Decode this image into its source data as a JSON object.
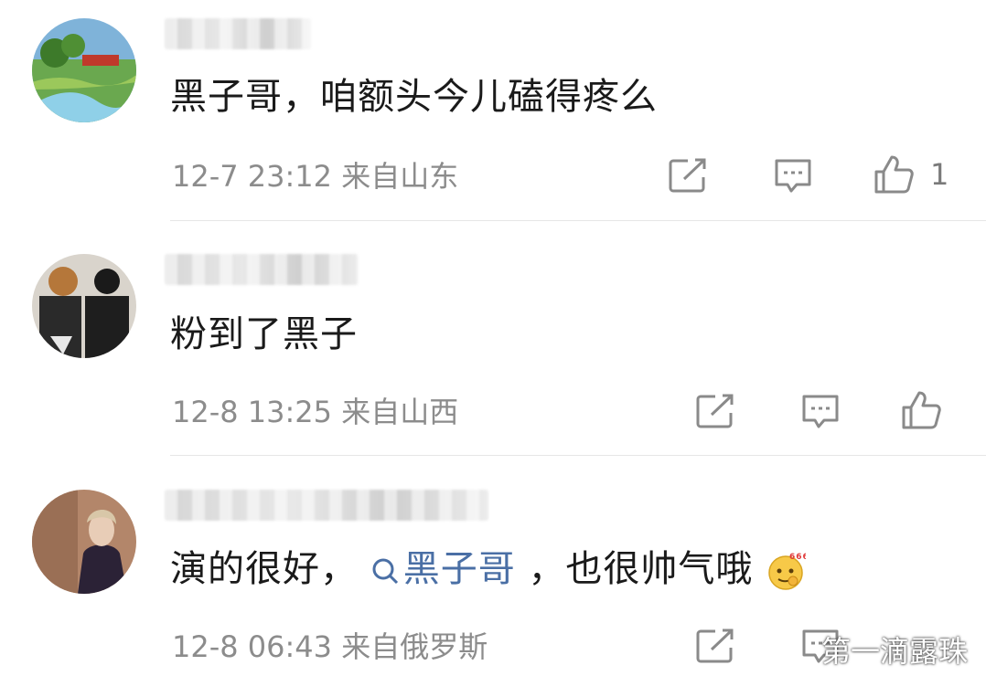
{
  "comments": [
    {
      "text": "黑子哥，咱额头今儿磕得疼么",
      "meta": "12-7 23:12 来自山东",
      "like_count": "1"
    },
    {
      "text": "粉到了黑子",
      "meta": "12-8 13:25 来自山西",
      "like_count": ""
    },
    {
      "text_before": "演的很好，",
      "link": "黑子哥",
      "text_after": "，也很帅气哦",
      "meta": "12-8 06:43 来自俄罗斯",
      "like_count": ""
    }
  ],
  "icons": {
    "share": "share-icon",
    "reply": "comment-icon",
    "like": "thumbs-up-icon",
    "search": "search-icon",
    "emoji": "666-emoji-icon"
  },
  "colors": {
    "text": "#1a1a1a",
    "meta": "#8c8c8c",
    "link": "#4a6fa5",
    "divider": "#e6e6e6"
  },
  "watermark": "第一滴露珠"
}
